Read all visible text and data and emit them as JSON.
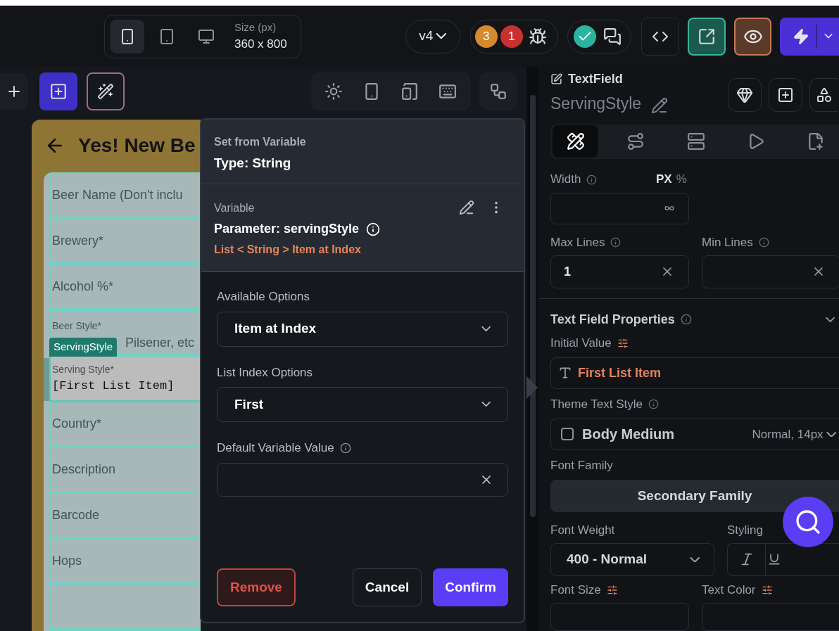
{
  "toolbar": {
    "devices": [
      {
        "kind": "phone",
        "selected": true
      },
      {
        "kind": "tablet",
        "selected": false
      },
      {
        "kind": "desktop",
        "selected": false
      }
    ],
    "size_label": "Size (px)",
    "size_value": "360 x 800",
    "version": "v4",
    "issue_badges": [
      {
        "count": "3",
        "color": "#d68a2e"
      },
      {
        "count": "1",
        "color": "#c8312f"
      }
    ]
  },
  "phone": {
    "title": "Yes! New Be",
    "fields": [
      {
        "kind": "plain",
        "label": "Beer Name (Don't inclu"
      },
      {
        "kind": "plain",
        "label": "Brewery*"
      },
      {
        "kind": "plain",
        "label": "Alcohol %*"
      },
      {
        "kind": "small",
        "label": "Beer Style*",
        "placeholder": "Pilsener, etc"
      },
      {
        "kind": "selected",
        "label": "Serving Style*",
        "value": "[First List Item]",
        "tag": "ServingStyle"
      },
      {
        "kind": "plain",
        "label": "Country*"
      },
      {
        "kind": "plain",
        "label": "Description"
      },
      {
        "kind": "plain",
        "label": "Barcode"
      },
      {
        "kind": "plain",
        "label": "Hops"
      },
      {
        "kind": "empty"
      }
    ]
  },
  "dialog": {
    "title": "Set from Variable",
    "type": "Type: String",
    "variable_label": "Variable",
    "variable_name": "Parameter: servingStyle",
    "variable_path": "List < String > Item at Index",
    "fields": [
      {
        "kind": "dropdown",
        "label": "Available Options",
        "value": "Item at Index"
      },
      {
        "kind": "dropdown",
        "label": "List Index Options",
        "value": "First"
      },
      {
        "kind": "clearable",
        "label": "Default Variable Value",
        "info": true
      }
    ],
    "buttons": [
      {
        "kind": "danger",
        "label": "Remove"
      },
      {
        "kind": "secondary",
        "label": "Cancel"
      },
      {
        "kind": "primary",
        "label": "Confirm"
      }
    ]
  },
  "panel": {
    "widget_type": "TextField",
    "widget_name": "ServingStyle",
    "tabs": [
      {
        "kind": "design",
        "selected": true
      },
      {
        "kind": "actions",
        "selected": false
      },
      {
        "kind": "backend",
        "selected": false
      },
      {
        "kind": "preview",
        "selected": false
      },
      {
        "kind": "notes",
        "selected": false
      }
    ],
    "width_label": "Width",
    "units": [
      {
        "label": "PX",
        "selected": true
      },
      {
        "label": "%",
        "selected": false
      }
    ],
    "max_lines_label": "Max Lines",
    "max_lines_value": "1",
    "min_lines_label": "Min Lines",
    "section_title": "Text Field Properties",
    "initial_value_label": "Initial Value",
    "initial_value": "First List Item",
    "theme_style_label": "Theme Text Style",
    "theme_style": {
      "checked": false,
      "name": "Body Medium",
      "detail": "Normal, 14px"
    },
    "font_family_label": "Font Family",
    "font_family": "Secondary Family",
    "font_weight_label": "Font Weight",
    "font_weight": "400 - Normal",
    "styling_label": "Styling",
    "font_size_label": "Font Size",
    "text_color_label": "Text Color"
  }
}
